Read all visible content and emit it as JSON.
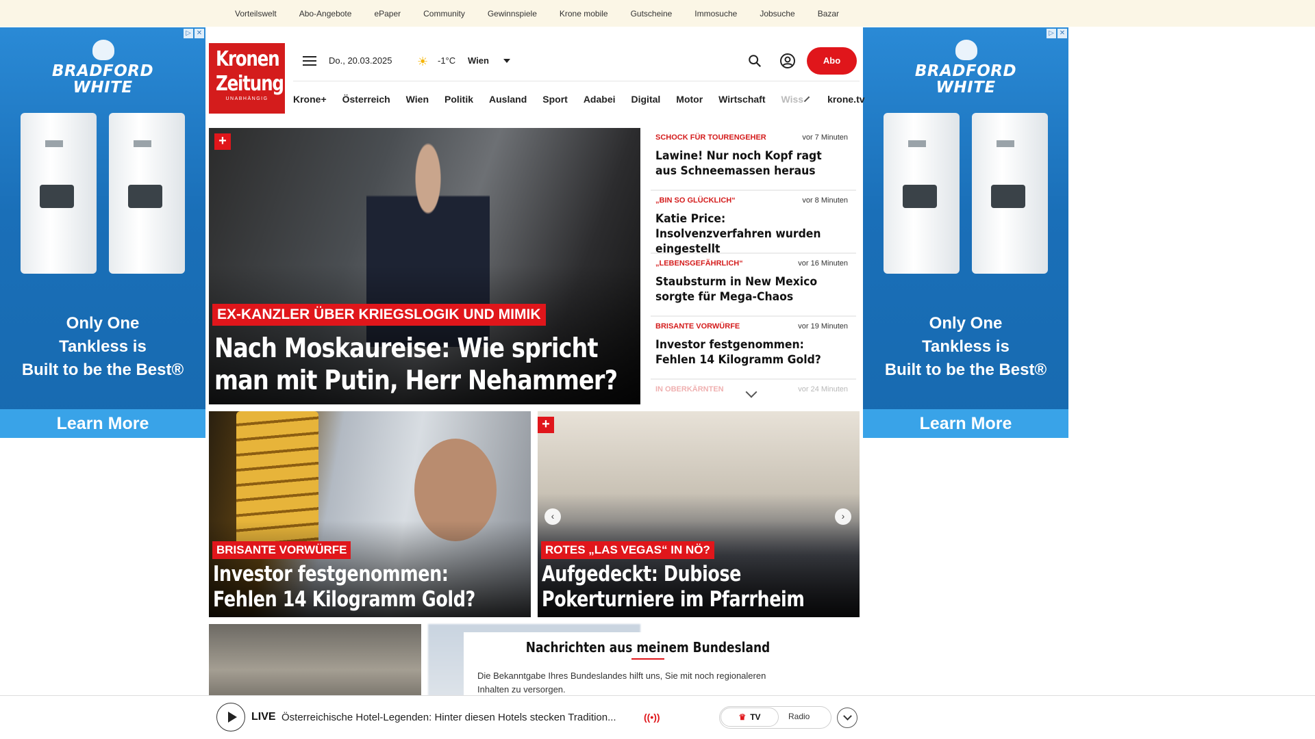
{
  "topbar": {
    "links": [
      "Vorteilswelt",
      "Abo-Angebote",
      "ePaper",
      "Community",
      "Gewinnspiele",
      "Krone mobile",
      "Gutscheine",
      "Immosuche",
      "Jobsuche",
      "Bazar"
    ]
  },
  "ads": {
    "brand_line1": "BRADFORD",
    "brand_line2": "WHITE",
    "slogan_line1": "Only One",
    "slogan_line2": "Tankless is",
    "slogan_line3": "Built to be the Best®",
    "cta": "Learn More"
  },
  "header": {
    "logo_line1": "Kronen",
    "logo_line2": "Zeitung",
    "logo_sub": "UNABHÄNGIG",
    "date": "Do., 20.03.2025",
    "temperature": "-1°C",
    "city": "Wien",
    "abo_label": "Abo",
    "nav": [
      "Krone+",
      "Österreich",
      "Wien",
      "Politik",
      "Ausland",
      "Sport",
      "Adabei",
      "Digital",
      "Motor",
      "Wirtschaft"
    ],
    "nav_faded": "Wiss",
    "nav_tv": "krone.tv"
  },
  "hero": {
    "kicker": "EX-KANZLER ÜBER KRIEGSLOGIK UND MIMIK",
    "headline_line1": "Nach Moskaureise: Wie spricht",
    "headline_line2": "man mit Putin, Herr Nehammer?"
  },
  "sidelist": [
    {
      "kicker": "SCHOCK FÜR TOURENGEHER",
      "time": "vor 7 Minuten",
      "headline": "Lawine! Nur noch Kopf ragt aus Schneemassen heraus"
    },
    {
      "kicker": "„BIN SO GLÜCKLICH“",
      "time": "vor 8 Minuten",
      "headline": "Katie Price: Insolvenzverfahren wurden eingestellt"
    },
    {
      "kicker": "„LEBENSGEFÄHRLICH“",
      "time": "vor 16 Minuten",
      "headline": "Staubsturm in New Mexico sorgte für Mega-Chaos"
    },
    {
      "kicker": "BRISANTE VORWÜRFE",
      "time": "vor 19 Minuten",
      "headline": "Investor festgenommen: Fehlen 14 Kilogramm Gold?"
    },
    {
      "kicker": "IN OBERKÄRNTEN",
      "time": "vor 24 Minuten",
      "headline": ""
    }
  ],
  "cards": [
    {
      "kicker": "BRISANTE VORWÜRFE",
      "headline_line1": "Investor festgenommen:",
      "headline_line2": "Fehlen 14 Kilogramm Gold?"
    },
    {
      "kicker": "ROTES „LAS VEGAS“ IN NÖ?",
      "headline_line1": "Aufgedeckt: Dubiose",
      "headline_line2": "Pokerturniere im Pfarrheim"
    }
  ],
  "bundesland": {
    "title": "Nachrichten aus meinem Bundesland",
    "text": "Die Bekanntgabe Ihres Bundeslandes hilft uns, Sie mit noch regionaleren Inhalten zu versorgen."
  },
  "player": {
    "live_label": "LIVE",
    "title": "Österreichische Hotel-Legenden: Hinter diesen Hotels stecken Tradition...",
    "tv_label": "TV",
    "radio_label": "Radio"
  },
  "colors": {
    "brand_red": "#e0161b",
    "topbar_bg": "#fbf6e6",
    "ad_blue": "#1a6fb8"
  }
}
